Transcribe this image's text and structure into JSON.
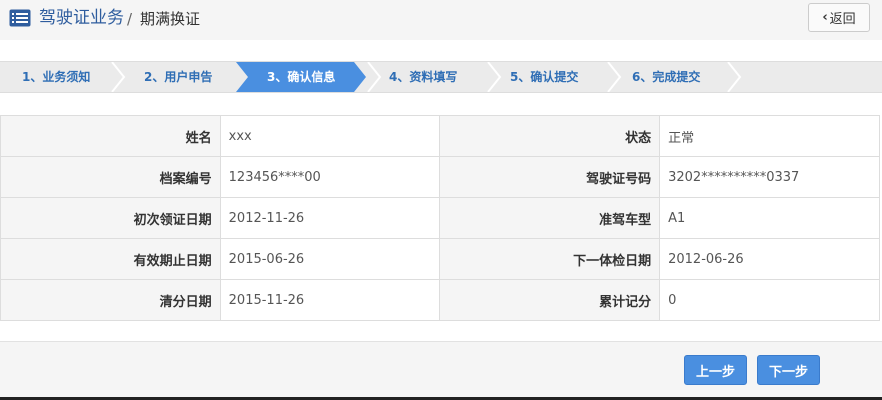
{
  "header": {
    "title": "驾驶证业务",
    "separator": "/",
    "subtitle": "期满换证",
    "back_label": "返回"
  },
  "steps": [
    {
      "label": "1、业务须知",
      "state": "done"
    },
    {
      "label": "2、用户申告",
      "state": "done"
    },
    {
      "label": "3、确认信息",
      "state": "active"
    },
    {
      "label": "4、资料填写",
      "state": "pending"
    },
    {
      "label": "5、确认提交",
      "state": "pending"
    },
    {
      "label": "6、完成提交",
      "state": "pending"
    }
  ],
  "info": {
    "rows": [
      {
        "l1": "姓名",
        "v1": "xxx",
        "l2": "状态",
        "v2": "正常"
      },
      {
        "l1": "档案编号",
        "v1": "123456****00",
        "l2": "驾驶证号码",
        "v2": "3202**********0337"
      },
      {
        "l1": "初次领证日期",
        "v1": "2012-11-26",
        "l2": "准驾车型",
        "v2": "A1"
      },
      {
        "l1": "有效期止日期",
        "v1": "2015-06-26",
        "l2": "下一体检日期",
        "v2": "2012-06-26"
      },
      {
        "l1": "清分日期",
        "v1": "2015-11-26",
        "l2": "累计记分",
        "v2": "0"
      }
    ]
  },
  "footer": {
    "prev_label": "上一步",
    "next_label": "下一步"
  },
  "colors": {
    "accent": "#4a8fe0",
    "title": "#2f5d9e",
    "step_text": "#2f6eb5"
  }
}
